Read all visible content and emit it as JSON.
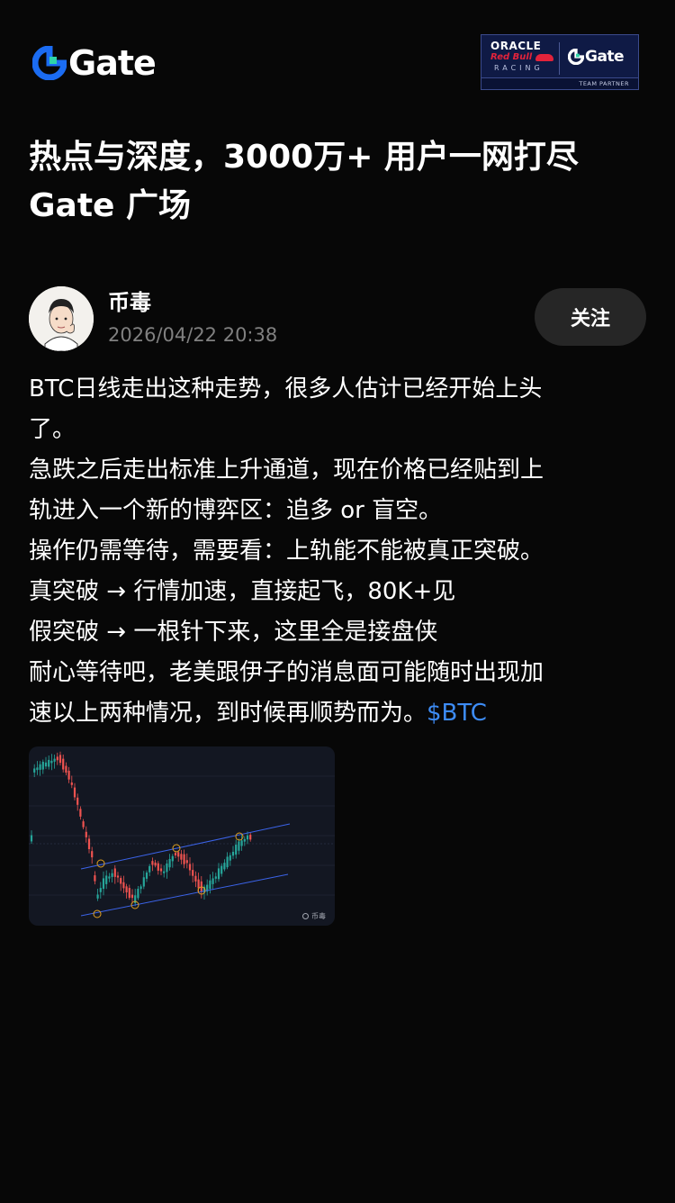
{
  "brand": {
    "logo_text": "Gate",
    "logo_color": "#1b6cf2"
  },
  "partner_badge": {
    "oracle": "ORACLE",
    "redbull": "Red Bull",
    "racing": "RACING",
    "gate": "Gate",
    "footer": "TEAM PARTNER"
  },
  "headline": {
    "line1": "热点与深度，3000万+ 用户一网打尽",
    "line2": "Gate 广场"
  },
  "post": {
    "author": "币毒",
    "timestamp": "2026/04/22 20:38",
    "follow_label": "关注",
    "lines": [
      "BTC日线走出这种走势，很多人估计已经开始上头",
      "了。",
      "急跌之后走出标准上升通道，现在价格已经贴到上",
      "轨进入一个新的博弈区：追多 or 盲空。",
      "操作仍需等待，需要看：上轨能不能被真正突破。",
      "真突破 → 行情加速，直接起飞，80K+见",
      "假突破 → 一根针下来，这里全是接盘侠",
      "耐心等待吧，老美跟伊子的消息面可能随时出现加"
    ],
    "last_line_text": "速以上两种情况，到时候再顺势而为。",
    "ticker": "$BTC",
    "ticker_color": "#3d8cf5"
  },
  "chart_image": {
    "watermark": "币毒",
    "up_color": "#26a69a",
    "down_color": "#ef5350",
    "channel_color": "#3b63e8",
    "marker_color": "#e0a020"
  }
}
